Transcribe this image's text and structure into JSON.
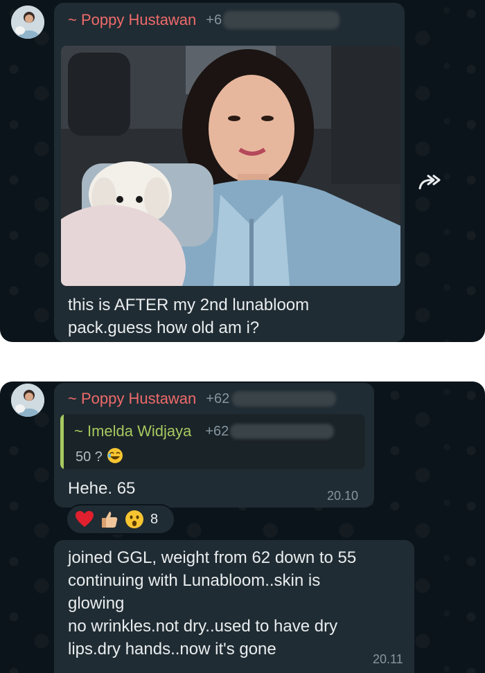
{
  "message_1": {
    "sender_name": "~ Poppy Hustawan",
    "sender_phone": "+6",
    "text_line_1": "this is AFTER my 2nd lunabloom",
    "text_line_2": "pack.guess how old am i?",
    "photo_description_icon": "selfie-photo",
    "forward_icon": "forward-icon"
  },
  "message_2": {
    "sender_name": "~ Poppy Hustawan",
    "sender_phone": "+62",
    "quote": {
      "name": "~ Imelda Widjaya",
      "phone": "+62",
      "text": "50 ?"
    },
    "text": "Hehe. 65",
    "time": "20.10",
    "reactions": {
      "icons": [
        "heart-icon",
        "thumbs-up-icon",
        "surprised-face-icon"
      ],
      "count": "8"
    }
  },
  "message_3": {
    "lines": [
      "joined GGL, weight from 62 down to 55",
      "continuing with Lunabloom..skin is",
      "glowing",
      "no wrinkles.not dry..used to have dry",
      "lips.dry hands..now it's gone"
    ],
    "time": "20.11"
  },
  "colors": {
    "background": "#0b141a",
    "bubble": "#202c33",
    "sender_name": "#ef6b6b",
    "quote_name": "#a6c95f",
    "meta_text": "#8696a0"
  }
}
